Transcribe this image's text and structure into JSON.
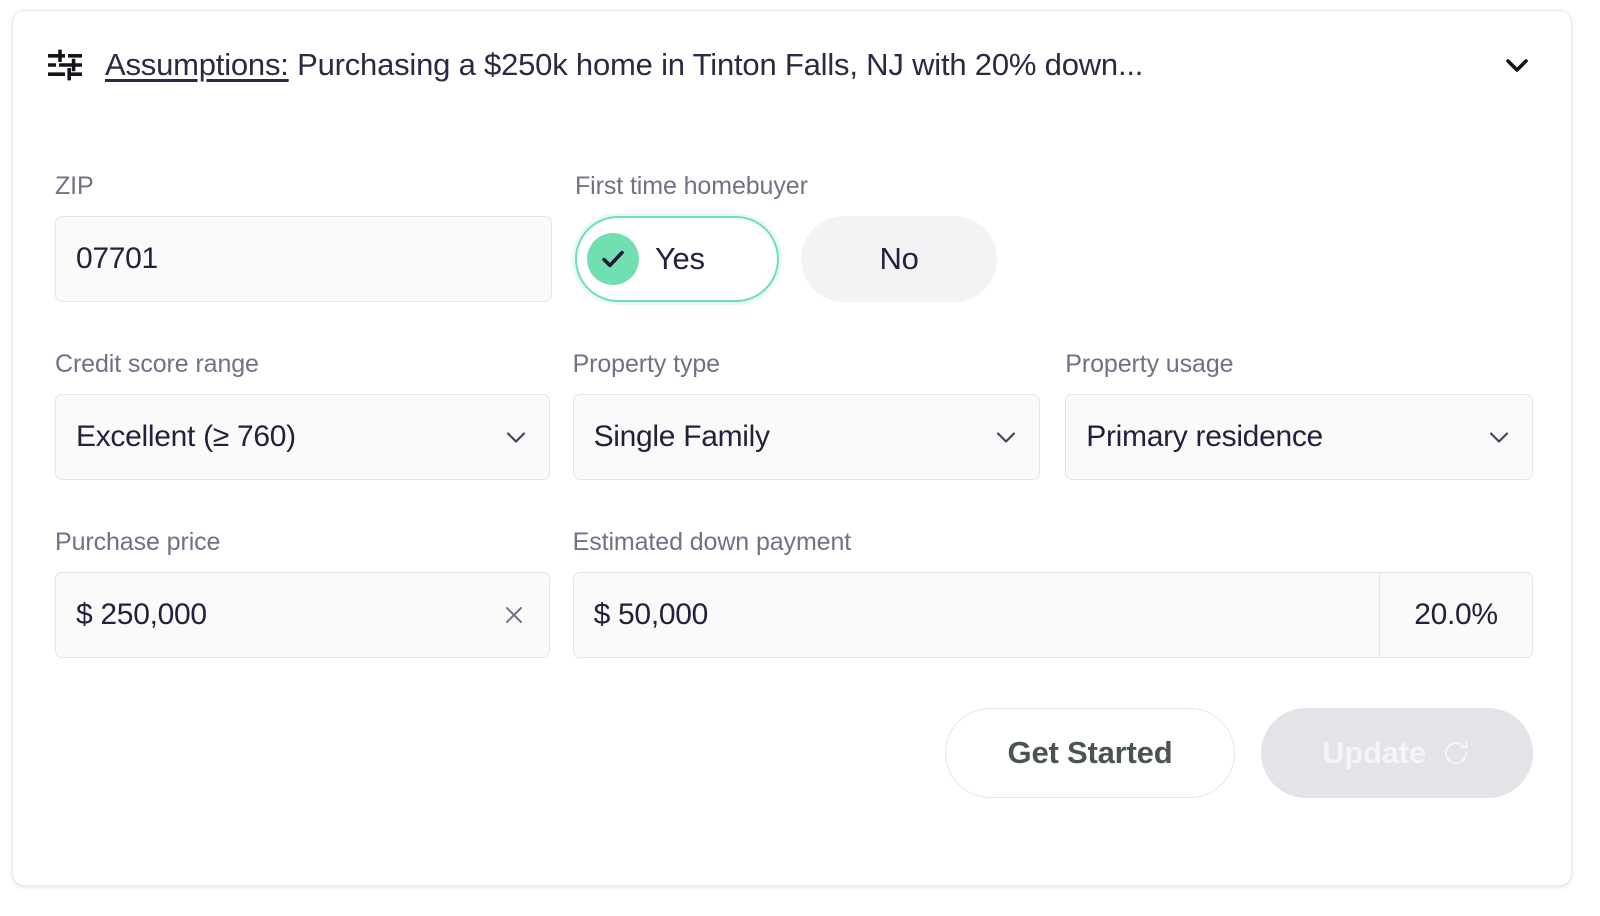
{
  "header": {
    "icon": "tune-sliders-icon",
    "link_label": "Assumptions:",
    "summary": " Purchasing a $250k home in Tinton Falls, NJ with 20% down...",
    "collapse_icon": "chevron-down-icon"
  },
  "fields": {
    "zip": {
      "label": "ZIP",
      "value": "07701",
      "placeholder": "ZIP"
    },
    "first_time_homebuyer": {
      "label": "First time homebuyer",
      "options": [
        "Yes",
        "No"
      ],
      "selected": "Yes",
      "yes_label": "Yes",
      "no_label": "No"
    },
    "credit_score": {
      "label": "Credit score range",
      "value": "Excellent (≥ 760)"
    },
    "property_type": {
      "label": "Property type",
      "value": "Single Family"
    },
    "property_usage": {
      "label": "Property usage",
      "value": "Primary residence"
    },
    "purchase_price": {
      "label": "Purchase price",
      "currency": "$",
      "value": "250,000",
      "display": "$ 250,000",
      "clear_icon": "close-icon"
    },
    "down_payment": {
      "label": "Estimated down payment",
      "currency": "$",
      "value": "50,000",
      "display": "$ 50,000",
      "percent": "20.0%"
    }
  },
  "actions": {
    "get_started_label": "Get Started",
    "update_label": "Update",
    "update_icon": "refresh-icon",
    "update_disabled": true
  },
  "colors": {
    "accent_green": "#72dfb3",
    "text_dark": "#231f3c",
    "label_gray": "#6f7285",
    "field_bg": "#fafafa",
    "field_border": "#e4e5e9",
    "disabled_btn": "#e3e4e7"
  }
}
